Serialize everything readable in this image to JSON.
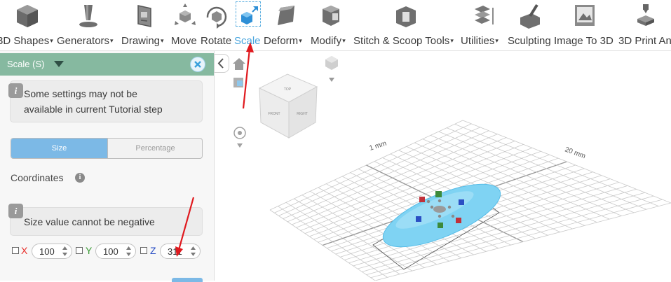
{
  "toolbar": {
    "items": [
      {
        "label": "3D Shapes",
        "caret": "▾",
        "icon": "cube-icon"
      },
      {
        "label": "Generators",
        "caret": "▾",
        "icon": "generator-icon"
      },
      {
        "label": "Drawing",
        "caret": "▾",
        "icon": "drawing-icon"
      },
      {
        "label": "Move",
        "caret": "",
        "icon": "move-icon"
      },
      {
        "label": "Rotate",
        "caret": "",
        "icon": "rotate-icon"
      },
      {
        "label": "Scale",
        "caret": "",
        "icon": "scale-icon"
      },
      {
        "label": "Deform",
        "caret": "▾",
        "icon": "deform-icon"
      },
      {
        "label": "Modify",
        "caret": "▾",
        "icon": "modify-icon"
      },
      {
        "label": "Stitch & Scoop Tools",
        "caret": "▾",
        "icon": "stitch-scoop-icon"
      },
      {
        "label": "Utilities",
        "caret": "▾",
        "icon": "utilities-icon"
      },
      {
        "label": "Sculpting",
        "caret": "",
        "icon": "sculpting-icon"
      },
      {
        "label": "Image To 3D",
        "caret": "",
        "icon": "image-to-3d-icon"
      },
      {
        "label": "3D Print An",
        "caret": "",
        "icon": "3d-print-icon"
      }
    ]
  },
  "panel": {
    "title": "Scale (S)",
    "note1": {
      "line1": "Some settings may not be",
      "line2": "available in current Tutorial step",
      "icon_glyph": "i"
    },
    "tabs": {
      "size": "Size",
      "percentage": "Percentage"
    },
    "coordinates_label": "Coordinates",
    "coordinates_info_glyph": "i",
    "note2": {
      "text": "Size value cannot be negative",
      "icon_glyph": "i"
    },
    "axes": [
      {
        "label": "X",
        "value": "100",
        "color": "#e8322e"
      },
      {
        "label": "Y",
        "value": "100",
        "color": "#3a9a35"
      },
      {
        "label": "Z",
        "value": "311",
        "color": "#2a4fc4"
      }
    ]
  },
  "viewport": {
    "view_cube_faces": {
      "top": "TOP",
      "front": "FRONT",
      "right": "RIGHT"
    },
    "grid_labels": [
      "1 mm",
      "20 mm"
    ]
  },
  "colors": {
    "accent": "#4aa6de",
    "panel_header": "#86b9a0",
    "object": "#7fd3f3"
  }
}
